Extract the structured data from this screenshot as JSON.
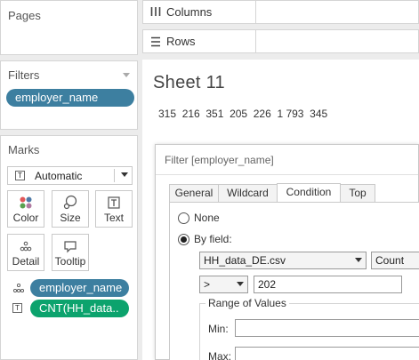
{
  "left_panel": {
    "pages_title": "Pages",
    "filters_title": "Filters",
    "filter_pill": "employer_name",
    "marks_title": "Marks",
    "mark_type": "Automatic",
    "buttons": {
      "color": "Color",
      "size": "Size",
      "text": "Text",
      "detail": "Detail",
      "tooltip": "Tooltip"
    },
    "mark_pills": {
      "detail_field": "employer_name",
      "text_field": "CNT(HH_data.."
    }
  },
  "shelves": {
    "columns": "Columns",
    "rows": "Rows"
  },
  "sheet": {
    "title": "Sheet 11",
    "values": "315  216  351  205  226  1 793  345"
  },
  "dialog": {
    "title": "Filter [employer_name]",
    "tabs": [
      "General",
      "Wildcard",
      "Condition",
      "Top"
    ],
    "active_tab": "Condition",
    "option_none": "None",
    "option_by_field": "By field:",
    "field_source": "HH_data_DE.csv",
    "aggregation": "Count",
    "operator": ">",
    "value": "202",
    "range_title": "Range of Values",
    "min_label": "Min:",
    "max_label": "Max:"
  },
  "colors": {
    "pill_blue": "#3d7fa0",
    "pill_green": "#0ca36d"
  }
}
